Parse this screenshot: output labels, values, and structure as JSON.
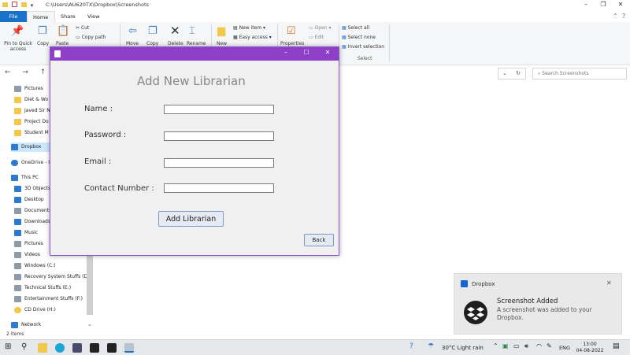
{
  "explorer": {
    "path": "C:\\Users\\AU620TX\\Dropbox\\Screenshots",
    "tabs": [
      "File",
      "Home",
      "Share",
      "View"
    ],
    "ribbon": {
      "pin_quick_access": "Pin to Quick access",
      "copy": "Copy",
      "paste": "Paste",
      "cut": "Cut",
      "copy_path": "Copy path",
      "move_to": "Move",
      "copy_to": "Copy",
      "delete": "Delete",
      "rename": "Rename",
      "new_folder": "New",
      "new_item": "New item",
      "easy_access": "Easy access",
      "properties": "Properties",
      "open": "Open",
      "edit": "Edit",
      "select_all": "Select all",
      "select_none": "Select none",
      "invert_selection": "Invert selection",
      "select_group": "Select"
    },
    "search_placeholder": "Search Screenshots",
    "nav_items": [
      {
        "label": "Pictures",
        "icon": "pictures-icon"
      },
      {
        "label": "Diet & Wo",
        "icon": "folder-icon"
      },
      {
        "label": "Javed Sir N",
        "icon": "folder-icon"
      },
      {
        "label": "Project Do",
        "icon": "folder-icon"
      },
      {
        "label": "Student M",
        "icon": "folder-icon"
      },
      {
        "label": "Dropbox",
        "icon": "dropbox-icon"
      },
      {
        "label": "OneDrive - I",
        "icon": "onedrive-icon"
      },
      {
        "label": "This PC",
        "icon": "pc-icon"
      },
      {
        "label": "3D Objects",
        "icon": "3d-objects-icon"
      },
      {
        "label": "Desktop",
        "icon": "desktop-icon"
      },
      {
        "label": "Documents",
        "icon": "documents-icon"
      },
      {
        "label": "Downloads",
        "icon": "downloads-icon"
      },
      {
        "label": "Music",
        "icon": "music-icon"
      },
      {
        "label": "Pictures",
        "icon": "pictures-icon"
      },
      {
        "label": "Videos",
        "icon": "videos-icon"
      },
      {
        "label": "Windows (C:)",
        "icon": "drive-icon"
      },
      {
        "label": "Recovery System Stuffs (D:",
        "icon": "drive-icon"
      },
      {
        "label": "Technical Stuffs (E:)",
        "icon": "drive-icon"
      },
      {
        "label": "Entertainment Stuffs (F:)",
        "icon": "drive-icon"
      },
      {
        "label": "CD Drive (H:)",
        "icon": "cd-drive-icon"
      },
      {
        "label": "Network",
        "icon": "network-icon"
      }
    ],
    "status": "2 items"
  },
  "dialog": {
    "heading": "Add New Librarian",
    "name_label": "Name :",
    "password_label": "Password :",
    "email_label": "Email :",
    "contact_label": "Contact Number :",
    "name_value": "",
    "password_value": "",
    "email_value": "",
    "contact_value": "",
    "add_button": "Add Librarian",
    "back_button": "Back"
  },
  "toast": {
    "app": "Dropbox",
    "title": "Screenshot Added",
    "body": "A screenshot was added to your Dropbox."
  },
  "taskbar": {
    "weather": "30°C  Light rain",
    "language": "ENG",
    "time": "13:00",
    "date": "04-08-2022"
  }
}
